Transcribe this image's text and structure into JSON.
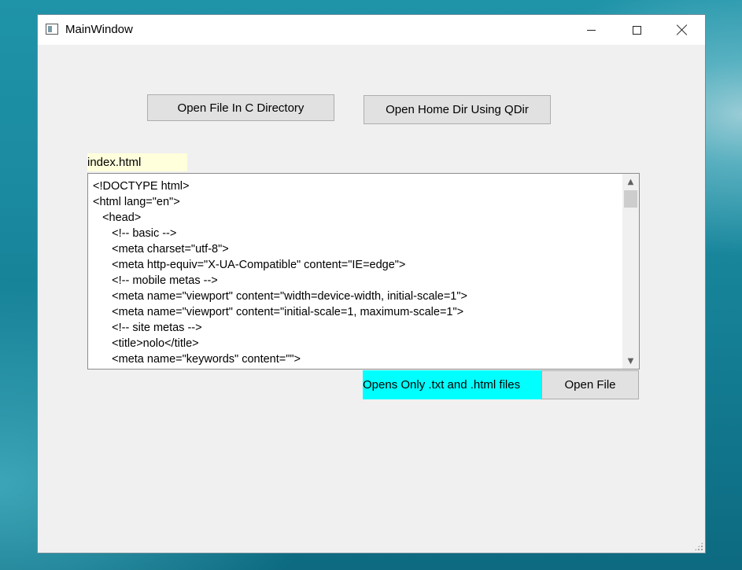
{
  "window": {
    "title": "MainWindow",
    "icons": {
      "app": "app-window-icon",
      "minimize": "minimize-icon",
      "maximize": "maximize-icon",
      "close": "close-icon"
    }
  },
  "buttons": {
    "open_c_dir": "Open File In C Directory",
    "open_home_dir": "Open Home Dir Using QDir",
    "open_file": "Open File"
  },
  "file_label": "index.html",
  "hint_label": "Opens Only .txt and .html files",
  "editor": {
    "lines": [
      "<!DOCTYPE html>",
      "<html lang=\"en\">",
      "   <head>",
      "      <!-- basic -->",
      "      <meta charset=\"utf-8\">",
      "      <meta http-equiv=\"X-UA-Compatible\" content=\"IE=edge\">",
      "      <!-- mobile metas -->",
      "      <meta name=\"viewport\" content=\"width=device-width, initial-scale=1\">",
      "      <meta name=\"viewport\" content=\"initial-scale=1, maximum-scale=1\">",
      "      <!-- site metas -->",
      "      <title>nolo</title>",
      "      <meta name=\"keywords\" content=\"\">"
    ]
  },
  "colors": {
    "label_bg": "#ffffdc",
    "hint_bg": "#00ffff",
    "window_bg": "#f0f0f0",
    "button_bg": "#e1e1e1"
  }
}
